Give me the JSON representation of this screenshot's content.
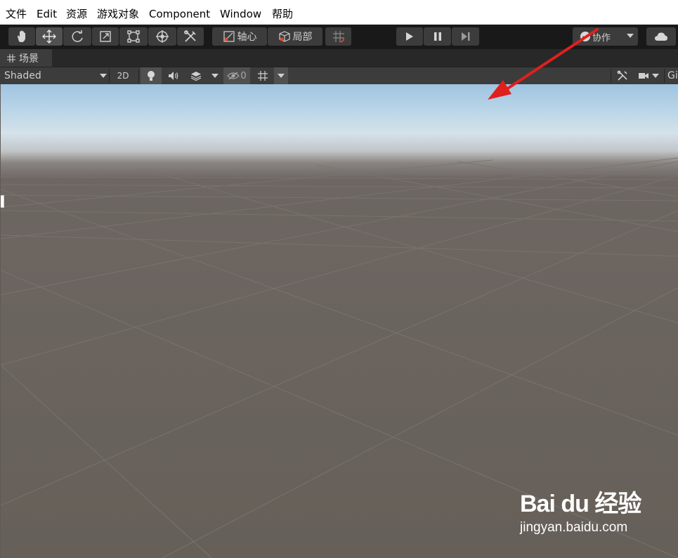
{
  "menubar": {
    "items": [
      "文件",
      "Edit",
      "资源",
      "游戏对象",
      "Component",
      "Window",
      "帮助"
    ]
  },
  "toolbar": {
    "tools": [
      "hand-tool",
      "move-tool",
      "rotate-tool",
      "scale-tool",
      "rect-tool",
      "transform-tool",
      "custom-tool"
    ],
    "pivot_label": "轴心",
    "local_label": "局部",
    "collab_label": "协作"
  },
  "scene_tab": {
    "label": "场景"
  },
  "scene_toolbar": {
    "shading_mode": "Shaded",
    "two_d_label": "2D",
    "hidden_count": "0",
    "gizmos_label": "Gi"
  },
  "watermark": {
    "logo": "Bai du 经验",
    "site": "jingyan.baidu.com"
  },
  "colors": {
    "arrow": "#e0201c",
    "toolbar_bg": "#191919",
    "button_bg": "#3c3c3c",
    "ground": "#666059",
    "sky": "#9fc4e0"
  }
}
